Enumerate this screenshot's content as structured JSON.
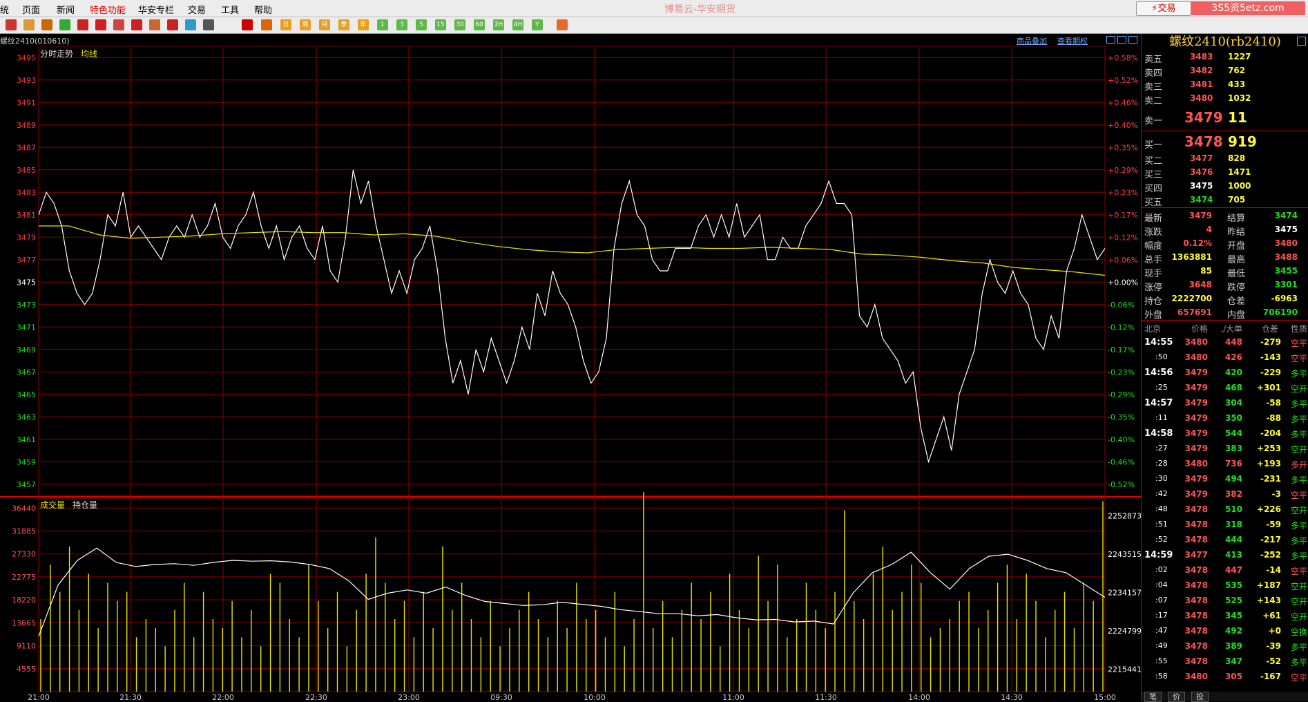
{
  "menu": {
    "items": [
      "统",
      "页面",
      "新闻",
      "特色功能",
      "华安专栏",
      "交易",
      "工具",
      "帮助"
    ],
    "highlight_index": 3,
    "app_title": "博易云-华安期货",
    "trade_button": "⚡交易",
    "watermark": "3S5资5etz.com"
  },
  "toolbar": {
    "icons": [
      "home-icon",
      "book-icon",
      "folder-icon",
      "refresh-icon",
      "zoom-in-icon",
      "zoom-out-icon",
      "window-icon",
      "pen-icon",
      "ruler-icon",
      "filter-icon",
      "news-icon",
      "list-icon",
      "trend-icon",
      "candle-icon"
    ],
    "periods": [
      "日",
      "周",
      "月",
      "季",
      "年",
      "1",
      "3",
      "5",
      "15",
      "30",
      "60",
      "2H",
      "4H",
      "Y"
    ]
  },
  "info": {
    "contract": "螺纹2410(010610)",
    "link_overlay": "商品叠加",
    "link_options": "查看期权"
  },
  "chart_data": [
    {
      "type": "line",
      "series": [
        {
          "name": "分时走势",
          "values": [
            3481,
            3483,
            3482,
            3480,
            3476,
            3474,
            3473,
            3474,
            3477,
            3481,
            3480,
            3483,
            3479,
            3480,
            3479,
            3478,
            3477,
            3479,
            3480,
            3479,
            3481,
            3479,
            3480,
            3482,
            3479,
            3478,
            3480,
            3481,
            3483,
            3480,
            3478,
            3480,
            3477,
            3479,
            3480,
            3478,
            3477,
            3480,
            3476,
            3475,
            3479,
            3485,
            3482,
            3484,
            3480,
            3477,
            3474,
            3476,
            3474,
            3477,
            3478,
            3480,
            3476,
            3470,
            3466,
            3468,
            3465,
            3469,
            3467,
            3470,
            3468,
            3466,
            3468,
            3471,
            3469,
            3474,
            3472,
            3476,
            3474,
            3473,
            3471,
            3468,
            3466,
            3467,
            3470,
            3478,
            3482,
            3484,
            3481,
            3480,
            3477,
            3476,
            3476,
            3478,
            3478,
            3478,
            3480,
            3481,
            3479,
            3481,
            3479,
            3482,
            3479,
            3480,
            3481,
            3477,
            3477,
            3479,
            3478,
            3478,
            3480,
            3481,
            3482,
            3484,
            3482,
            3482,
            3481,
            3472,
            3471,
            3473,
            3470,
            3469,
            3468,
            3466,
            3467,
            3462,
            3459,
            3461,
            3463,
            3460,
            3465,
            3467,
            3469,
            3474,
            3477,
            3475,
            3474,
            3476,
            3474,
            3473,
            3470,
            3469,
            3472,
            3470,
            3476,
            3478,
            3481,
            3479,
            3477,
            3478
          ]
        },
        {
          "name": "均线",
          "values": [
            3480,
            3480,
            3479.2,
            3478.9,
            3479,
            3479.1,
            3479.3,
            3479.4,
            3479.5,
            3479.4,
            3479.4,
            3479.2,
            3479.3,
            3479.1,
            3478.6,
            3478.2,
            3477.9,
            3477.7,
            3477.6,
            3477.9,
            3478,
            3478.1,
            3478,
            3478,
            3478.1,
            3478,
            3477.9,
            3477.5,
            3477.4,
            3477.2,
            3476.9,
            3476.7,
            3476.3,
            3476.1,
            3475.9,
            3475.6
          ]
        }
      ],
      "x_ticks": [
        "21:00",
        "21:30",
        "22:00",
        "22:30",
        "23:00",
        "09:30",
        "10:00",
        "11:00",
        "11:30",
        "14:00",
        "14:30",
        "15:00"
      ],
      "y_ticks_left": [
        3495,
        3493,
        3491,
        3489,
        3487,
        3485,
        3483,
        3481,
        3479,
        3477,
        3475,
        3473,
        3471,
        3469,
        3467,
        3465,
        3463,
        3461,
        3459,
        3457
      ],
      "y_ticks_right": [
        "+0.58%",
        "+0.52%",
        "+0.46%",
        "+0.40%",
        "+0.35%",
        "+0.29%",
        "+0.23%",
        "+0.17%",
        "+0.12%",
        "+0.06%",
        "+0.00%",
        "-0.06%",
        "-0.12%",
        "-0.17%",
        "-0.23%",
        "-0.29%",
        "-0.35%",
        "-0.40%",
        "-0.46%",
        "-0.52%"
      ],
      "ylim": [
        3456,
        3496
      ],
      "grid": true
    },
    {
      "type": "bar",
      "series": [
        {
          "name": "成交量",
          "values": [
            8,
            14,
            11,
            16,
            9,
            13,
            7,
            12,
            10,
            11,
            6,
            8,
            7,
            5,
            9,
            12,
            6,
            11,
            8,
            7,
            10,
            6,
            9,
            5,
            13,
            12,
            8,
            6,
            14,
            10,
            7,
            11,
            5,
            9,
            13,
            17,
            12,
            8,
            10,
            6,
            11,
            7,
            16,
            9,
            12,
            8,
            6,
            10,
            5,
            7,
            9,
            11,
            8,
            6,
            10,
            7,
            12,
            8,
            9,
            6,
            11,
            5,
            8,
            22,
            7,
            10,
            6,
            9,
            12,
            8,
            11,
            5,
            13,
            9,
            7,
            15,
            10,
            14,
            6,
            8,
            12,
            9,
            7,
            11,
            20,
            10,
            8,
            13,
            16,
            9,
            11,
            14,
            12,
            6,
            7,
            8,
            10,
            11,
            7,
            9,
            12,
            14,
            8,
            13,
            10,
            6,
            9,
            11,
            7,
            12,
            10,
            21
          ]
        },
        {
          "name": "持仓量",
          "values": [
            2223500,
            2236000,
            2242000,
            2245000,
            2241500,
            2240500,
            2241000,
            2241200,
            2240800,
            2241500,
            2242000,
            2241800,
            2241900,
            2241600,
            2241000,
            2240000,
            2237000,
            2232500,
            2234000,
            2234800,
            2234000,
            2235500,
            2233500,
            2232000,
            2231500,
            2231000,
            2231200,
            2231800,
            2231300,
            2230800,
            2230000,
            2229500,
            2229000,
            2229000,
            2228500,
            2228800,
            2228000,
            2227500,
            2227600,
            2227000,
            2227200,
            2226500,
            2234000,
            2239000,
            2241000,
            2244000,
            2239000,
            2235000,
            2240000,
            2243000,
            2243500,
            2242000,
            2240000,
            2239000,
            2236000,
            2233000
          ]
        }
      ],
      "y_ticks_left": [
        36440,
        31885,
        27330,
        22775,
        18220,
        13665,
        9110,
        4555
      ],
      "y_ticks_right": [
        2252873,
        2243515,
        2234157,
        2224799,
        2215441
      ]
    }
  ],
  "legend": {
    "main_1": "分时走势",
    "main_2": "均线",
    "sub_1": "成交量",
    "sub_2": "持仓量"
  },
  "panel": {
    "title": "螺纹2410(rb2410)",
    "asks": [
      {
        "label": "卖五",
        "price": "3483",
        "vol": "1227"
      },
      {
        "label": "卖四",
        "price": "3482",
        "vol": "762"
      },
      {
        "label": "卖三",
        "price": "3481",
        "vol": "433"
      },
      {
        "label": "卖二",
        "price": "3480",
        "vol": "1032"
      },
      {
        "label": "卖一",
        "price": "3479",
        "vol": "11"
      }
    ],
    "bids": [
      {
        "label": "买一",
        "price": "3478",
        "vol": "919"
      },
      {
        "label": "买二",
        "price": "3477",
        "vol": "828"
      },
      {
        "label": "买三",
        "price": "3476",
        "vol": "1471"
      },
      {
        "label": "买四",
        "price": "3475",
        "vol": "1000"
      },
      {
        "label": "买五",
        "price": "3474",
        "vol": "705"
      }
    ],
    "stats": [
      {
        "l1": "最新",
        "v1": "3479",
        "c1": "red",
        "l2": "结算",
        "v2": "3474",
        "c2": "grn"
      },
      {
        "l1": "涨跌",
        "v1": "4",
        "c1": "red",
        "l2": "昨结",
        "v2": "3475",
        "c2": "wht"
      },
      {
        "l1": "幅度",
        "v1": "0.12%",
        "c1": "red",
        "l2": "开盘",
        "v2": "3480",
        "c2": "red"
      },
      {
        "l1": "总手",
        "v1": "1363881",
        "c1": "yel",
        "l2": "最高",
        "v2": "3488",
        "c2": "red"
      },
      {
        "l1": "现手",
        "v1": "85",
        "c1": "yel",
        "l2": "最低",
        "v2": "3455",
        "c2": "grn"
      },
      {
        "l1": "涨停",
        "v1": "3648",
        "c1": "red",
        "l2": "跌停",
        "v2": "3301",
        "c2": "grn"
      },
      {
        "l1": "持仓",
        "v1": "2222700",
        "c1": "yel",
        "l2": "仓差",
        "v2": "-6963",
        "c2": "yel"
      },
      {
        "l1": "外盘",
        "v1": "657691",
        "c1": "red",
        "l2": "内盘",
        "v2": "706190",
        "c2": "grn"
      }
    ],
    "tick_header": [
      "北京",
      "价格",
      "./大单",
      "仓差",
      "性质"
    ],
    "ticks": [
      {
        "time": "14:55",
        "price": "3480",
        "vol": "448",
        "oi": "-279",
        "kind": "空平",
        "pc": "red",
        "kc": "red"
      },
      {
        "time": ":50",
        "price": "3480",
        "vol": "426",
        "oi": "-143",
        "kind": "空平",
        "pc": "red",
        "kc": "red"
      },
      {
        "time": "14:56",
        "price": "3479",
        "vol": "420",
        "oi": "-229",
        "kind": "多平",
        "pc": "red",
        "kc": "grn"
      },
      {
        "time": ":25",
        "price": "3479",
        "vol": "468",
        "oi": "+301",
        "kind": "空开",
        "pc": "red",
        "kc": "grn"
      },
      {
        "time": "14:57",
        "price": "3479",
        "vol": "304",
        "oi": "-58",
        "kind": "多平",
        "pc": "red",
        "kc": "grn"
      },
      {
        "time": ":11",
        "price": "3479",
        "vol": "350",
        "oi": "-88",
        "kind": "多平",
        "pc": "red",
        "kc": "grn"
      },
      {
        "time": "14:58",
        "price": "3479",
        "vol": "544",
        "oi": "-204",
        "kind": "多平",
        "pc": "red",
        "kc": "grn"
      },
      {
        "time": ":27",
        "price": "3479",
        "vol": "383",
        "oi": "+253",
        "kind": "空开",
        "pc": "red",
        "kc": "grn"
      },
      {
        "time": ":28",
        "price": "3480",
        "vol": "736",
        "oi": "+193",
        "kind": "多开",
        "pc": "red",
        "kc": "red"
      },
      {
        "time": ":30",
        "price": "3479",
        "vol": "494",
        "oi": "-231",
        "kind": "多平",
        "pc": "red",
        "kc": "grn"
      },
      {
        "time": ":42",
        "price": "3479",
        "vol": "382",
        "oi": "-3",
        "kind": "空平",
        "pc": "red",
        "kc": "red"
      },
      {
        "time": ":48",
        "price": "3478",
        "vol": "510",
        "oi": "+226",
        "kind": "空开",
        "pc": "red",
        "kc": "grn"
      },
      {
        "time": ":51",
        "price": "3478",
        "vol": "318",
        "oi": "-59",
        "kind": "多平",
        "pc": "red",
        "kc": "grn"
      },
      {
        "time": ":52",
        "price": "3478",
        "vol": "444",
        "oi": "-217",
        "kind": "多平",
        "pc": "red",
        "kc": "grn"
      },
      {
        "time": "14:59",
        "price": "3477",
        "vol": "413",
        "oi": "-252",
        "kind": "多平",
        "pc": "red",
        "kc": "grn"
      },
      {
        "time": ":02",
        "price": "3478",
        "vol": "447",
        "oi": "-14",
        "kind": "空平",
        "pc": "red",
        "kc": "red"
      },
      {
        "time": ":04",
        "price": "3478",
        "vol": "535",
        "oi": "+187",
        "kind": "空开",
        "pc": "red",
        "kc": "grn"
      },
      {
        "time": ":07",
        "price": "3478",
        "vol": "525",
        "oi": "+143",
        "kind": "空开",
        "pc": "red",
        "kc": "grn"
      },
      {
        "time": ":17",
        "price": "3478",
        "vol": "345",
        "oi": "+61",
        "kind": "空开",
        "pc": "red",
        "kc": "grn"
      },
      {
        "time": ":47",
        "price": "3478",
        "vol": "492",
        "oi": "+0",
        "kind": "空换",
        "pc": "red",
        "kc": "grn"
      },
      {
        "time": ":49",
        "price": "3478",
        "vol": "389",
        "oi": "-39",
        "kind": "多平",
        "pc": "red",
        "kc": "grn"
      },
      {
        "time": ":55",
        "price": "3478",
        "vol": "347",
        "oi": "-52",
        "kind": "多平",
        "pc": "red",
        "kc": "grn"
      },
      {
        "time": ":58",
        "price": "3480",
        "vol": "305",
        "oi": "-167",
        "kind": "空平",
        "pc": "red",
        "kc": "red"
      }
    ],
    "tabs": [
      "笔",
      "价",
      "投"
    ]
  },
  "colors": {
    "grid": "#8a0000",
    "axis_red": "#ff3b3b",
    "axis_green": "#22dd22",
    "price_line": "#ffffff",
    "avg_line": "#e8e800",
    "vol_bar": "#e8e800",
    "oi_line": "#ffffff"
  }
}
